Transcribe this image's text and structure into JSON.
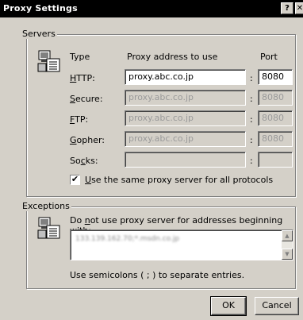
{
  "window": {
    "title": "Proxy Settings",
    "help_btn": "?",
    "close_btn": "✕"
  },
  "servers": {
    "legend": "Servers",
    "col_type": "Type",
    "col_address": "Proxy address to use",
    "col_port": "Port",
    "rows": [
      {
        "label": "HTTP:",
        "accel": "H",
        "rest": "TTP:",
        "address": "proxy.abc.co.jp",
        "port": "8080",
        "enabled": true
      },
      {
        "label": "Secure:",
        "accel": "S",
        "rest": "ecure:",
        "address": "proxy.abc.co.jp",
        "port": "8080",
        "enabled": false
      },
      {
        "label": "FTP:",
        "accel": "F",
        "rest": "TP:",
        "address": "proxy.abc.co.jp",
        "port": "8080",
        "enabled": false
      },
      {
        "label": "Gopher:",
        "accel": "G",
        "rest": "opher:",
        "address": "proxy.abc.co.jp",
        "port": "8080",
        "enabled": false
      },
      {
        "label": "Socks:",
        "pre": "So",
        "accel": "c",
        "rest": "ks:",
        "address": "",
        "port": "",
        "enabled": false
      }
    ],
    "same_proxy": {
      "pre": "",
      "accel": "U",
      "rest": "se the same proxy server for all protocols",
      "checked": "✔"
    }
  },
  "exceptions": {
    "legend": "Exceptions",
    "prompt_pre": "Do ",
    "prompt_accel": "n",
    "prompt_rest": "ot use proxy server for addresses beginning with:",
    "value": "133.139.162.70;*.msdn.co.jp",
    "hint": "Use semicolons ( ; ) to separate entries."
  },
  "buttons": {
    "ok": "OK",
    "cancel": "Cancel"
  },
  "colors": {
    "titlebar": "#000000",
    "face": "#d4d0c8"
  }
}
